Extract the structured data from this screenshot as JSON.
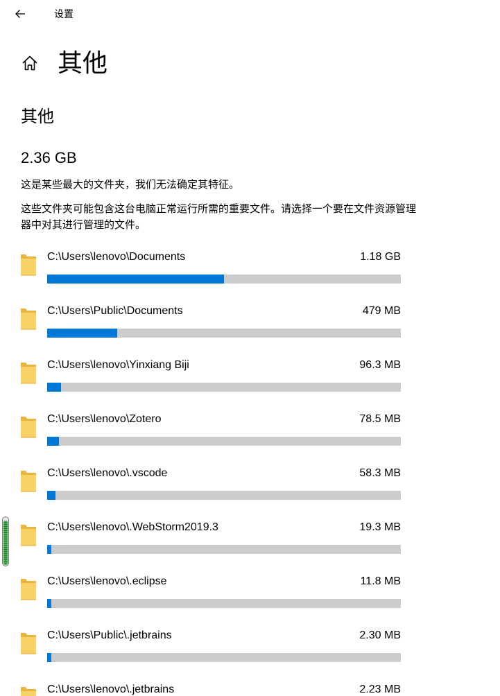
{
  "titlebar": {
    "app_title": "设置"
  },
  "header": {
    "title": "其他"
  },
  "section": {
    "title": "其他",
    "total_size": "2.36 GB",
    "description_1": "这是某些最大的文件夹，我们无法确定其特征。",
    "description_2": "这些文件夹可能包含这台电脑正常运行所需的重要文件。请选择一个要在文件资源管理器中对其进行管理的文件。"
  },
  "colors": {
    "accent": "#0078d7",
    "track": "#cccccc",
    "folder_body": "#f9d267",
    "folder_back": "#e9b53c"
  },
  "icons": {
    "back": "back-arrow-icon",
    "home": "home-icon",
    "folder": "folder-icon"
  },
  "folders": [
    {
      "path": "C:\\Users\\lenovo\\Documents",
      "size": "1.18 GB",
      "fraction": 0.5
    },
    {
      "path": "C:\\Users\\Public\\Documents",
      "size": "479 MB",
      "fraction": 0.198
    },
    {
      "path": "C:\\Users\\lenovo\\Yinxiang Biji",
      "size": "96.3 MB",
      "fraction": 0.04
    },
    {
      "path": "C:\\Users\\lenovo\\Zotero",
      "size": "78.5 MB",
      "fraction": 0.033
    },
    {
      "path": "C:\\Users\\lenovo\\.vscode",
      "size": "58.3 MB",
      "fraction": 0.024
    },
    {
      "path": "C:\\Users\\lenovo\\.WebStorm2019.3",
      "size": "19.3 MB",
      "fraction": 0.01
    },
    {
      "path": "C:\\Users\\lenovo\\.eclipse",
      "size": "11.8 MB",
      "fraction": 0.01
    },
    {
      "path": "C:\\Users\\Public\\.jetbrains",
      "size": "2.30 MB",
      "fraction": 0.01
    },
    {
      "path": "C:\\Users\\lenovo\\.jetbrains",
      "size": "2.23 MB",
      "fraction": 0.01
    }
  ],
  "scroll_indicator": {
    "fill_fraction": 0.94
  }
}
